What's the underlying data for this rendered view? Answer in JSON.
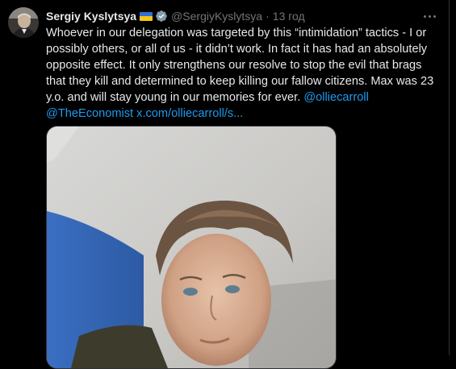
{
  "author": {
    "name": "Sergiy Kyslytsya",
    "handle": "@SergiyKyslytsya",
    "separator": "·",
    "time": "13 год"
  },
  "tweet": {
    "lines": [
      "Whoever in our delegation was targeted by this “intimidation” tactics - I or",
      "possibly others, or all of us - it didn’t work. In fact it has had an absolutely",
      "opposite effect. It only strengthens our resolve to stop the evil that brags",
      "that they kill and determined to keep killing our fallow citizens. Max was 23",
      "y.o. and will stay young in our memories for ever."
    ],
    "mention1": "@olliecarroll",
    "mention2": "@TheEconomist",
    "url": "x.com/olliecarroll/s..."
  },
  "colors": {
    "accent": "#1d9bf0",
    "background": "#000000",
    "muted": "#71767b",
    "flag_blue": "#2f6fd6",
    "flag_yellow": "#f5c518"
  },
  "icons": {
    "avatar": "profile-photo",
    "flag": "ukraine-flag-icon",
    "verified": "verified-badge-icon",
    "more": "more-options-icon"
  }
}
